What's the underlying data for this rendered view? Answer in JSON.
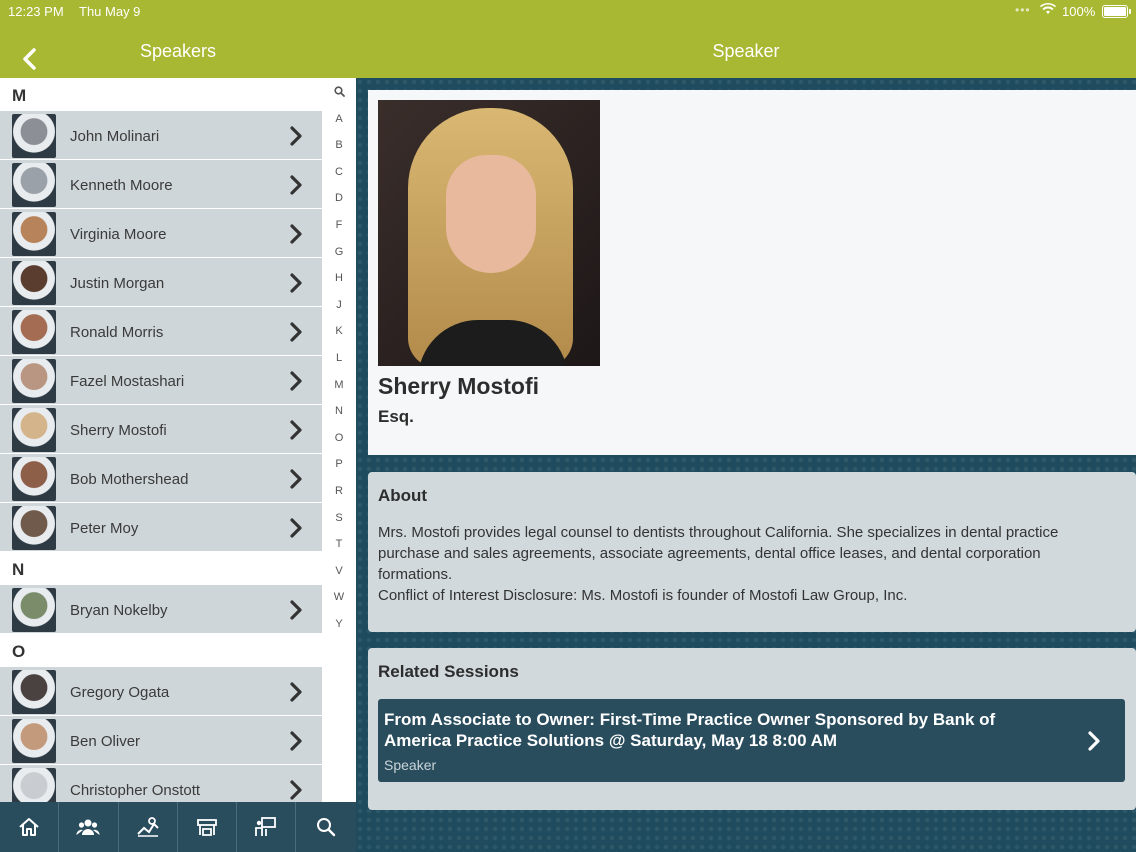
{
  "status": {
    "time": "12:23 PM",
    "date": "Thu May 9",
    "battery": "100%"
  },
  "header": {
    "left_title": "Speakers",
    "right_title": "Speaker"
  },
  "sections": [
    {
      "letter": "M",
      "items": [
        {
          "name": "John Molinari",
          "color": "#8c8f95"
        },
        {
          "name": "Kenneth Moore",
          "color": "#9aa1a8"
        },
        {
          "name": "Virginia Moore",
          "color": "#b7835a"
        },
        {
          "name": "Justin Morgan",
          "color": "#5a3d2e"
        },
        {
          "name": "Ronald Morris",
          "color": "#a46c52"
        },
        {
          "name": "Fazel Mostashari",
          "color": "#b99682"
        },
        {
          "name": "Sherry Mostofi",
          "color": "#d4b48a"
        },
        {
          "name": "Bob Mothershead",
          "color": "#8d5f49"
        },
        {
          "name": "Peter Moy",
          "color": "#6f5a4c"
        }
      ]
    },
    {
      "letter": "N",
      "items": [
        {
          "name": "Bryan Nokelby",
          "color": "#7a8c6a"
        }
      ]
    },
    {
      "letter": "O",
      "items": [
        {
          "name": "Gregory Ogata",
          "color": "#4a4240"
        },
        {
          "name": "Ben Oliver",
          "color": "#c49a7c"
        },
        {
          "name": "Christopher Onstott",
          "color": "#c9ccd0"
        }
      ]
    }
  ],
  "index_letters": [
    "A",
    "B",
    "C",
    "D",
    "F",
    "G",
    "H",
    "J",
    "K",
    "L",
    "M",
    "N",
    "O",
    "P",
    "R",
    "S",
    "T",
    "V",
    "W",
    "Y"
  ],
  "tabs": [
    "home-icon",
    "people-icon",
    "map-icon",
    "booth-icon",
    "presenter-icon",
    "search-icon"
  ],
  "speaker": {
    "name": "Sherry Mostofi",
    "title": "Esq.",
    "about_header": "About",
    "about_lines": [
      "Mrs. Mostofi provides legal counsel to dentists throughout California. She specializes in dental practice",
      "purchase and sales agreements, associate agreements, dental office leases, and dental corporation",
      "formations.",
      "Conflict of Interest Disclosure: Ms. Mostofi is founder of Mostofi Law Group, Inc."
    ],
    "related_header": "Related Sessions",
    "session": {
      "title": "From Associate to Owner: First-Time Practice Owner Sponsored by Bank of America Practice Solutions @ Saturday, May 18 8:00 AM",
      "role": "Speaker"
    }
  },
  "colors": {
    "brand": "#a8b832",
    "navy": "#2a4d5e",
    "row": "#cfd6da"
  }
}
